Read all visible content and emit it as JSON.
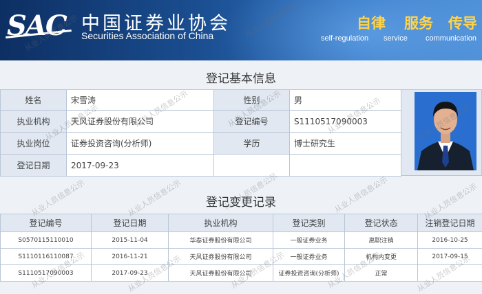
{
  "header": {
    "logo_text": "SAC",
    "cn_name": "中国证券业协会",
    "en_name": "Securities Association of China",
    "slogans": [
      {
        "cn": "自律",
        "en": "self-regulation"
      },
      {
        "cn": "服务",
        "en": "service"
      },
      {
        "cn": "传导",
        "en": "communication"
      }
    ]
  },
  "basic": {
    "title": "登记基本信息",
    "name_label": "姓名",
    "name_value": "宋雪涛",
    "gender_label": "性别",
    "gender_value": "男",
    "org_label": "执业机构",
    "org_value": "天风证券股份有限公司",
    "regno_label": "登记编号",
    "regno_value": "S1110517090003",
    "post_label": "执业岗位",
    "post_value": "证券投资咨询(分析师)",
    "edu_label": "学历",
    "edu_value": "博士研究生",
    "date_label": "登记日期",
    "date_value": "2017-09-23"
  },
  "changes": {
    "title": "登记变更记录",
    "columns": [
      "登记编号",
      "登记日期",
      "执业机构",
      "登记类别",
      "登记状态",
      "注销登记日期"
    ],
    "rows": [
      [
        "S0570115110010",
        "2015-11-04",
        "华泰证券股份有限公司",
        "一般证券业务",
        "离职注销",
        "2016-10-25"
      ],
      [
        "S1110116110087",
        "2016-11-21",
        "天风证券股份有限公司",
        "一般证券业务",
        "机构内变更",
        "2017-09-15"
      ],
      [
        "S1110517090003",
        "2017-09-23",
        "天风证券股份有限公司",
        "证券投资咨询(分析师)",
        "正常",
        ""
      ]
    ]
  },
  "watermark": "从业人员信息公示"
}
